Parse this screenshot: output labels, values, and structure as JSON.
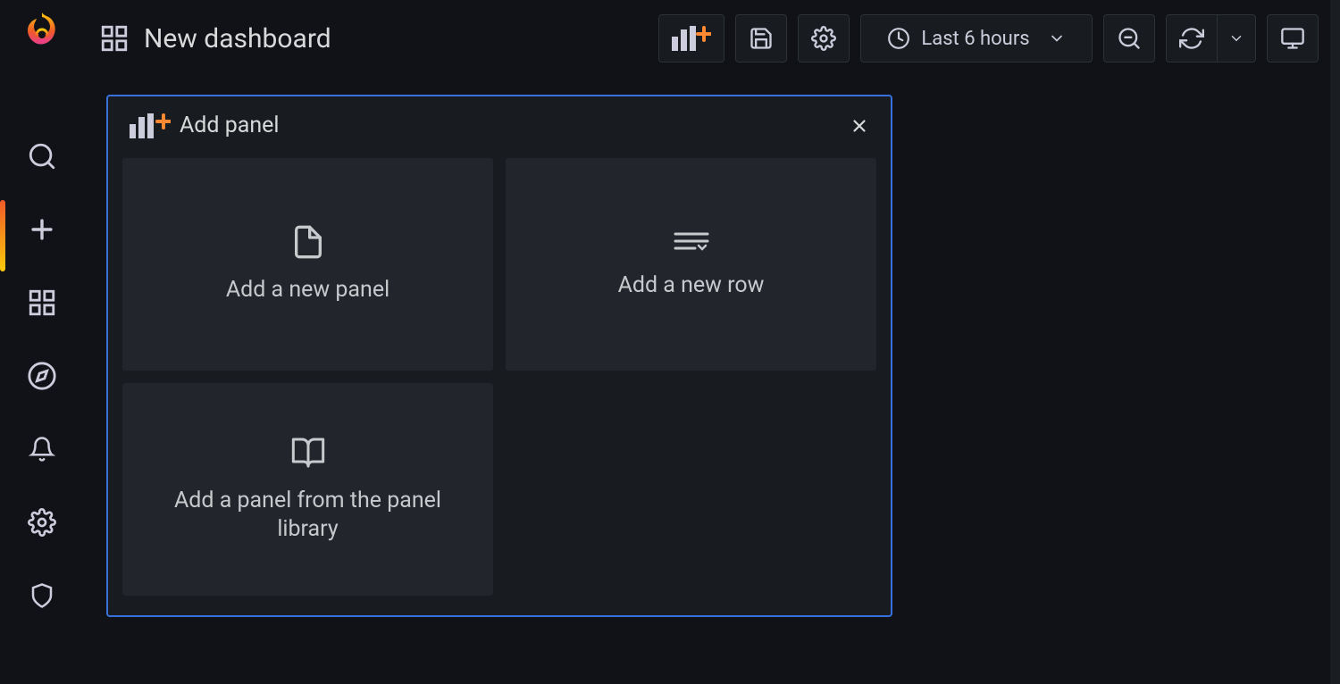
{
  "page": {
    "title": "New dashboard"
  },
  "sidebar": {
    "items": [
      {
        "icon": "search-icon"
      },
      {
        "icon": "plus-icon",
        "active": true
      },
      {
        "icon": "grid-icon"
      },
      {
        "icon": "compass-icon"
      },
      {
        "icon": "bell-icon"
      },
      {
        "icon": "gear-icon"
      },
      {
        "icon": "shield-icon"
      }
    ]
  },
  "toolbar": {
    "add_panel_icon": "add-panel-icon",
    "save_icon": "save-icon",
    "settings_icon": "gear-icon",
    "time_label": "Last 6 hours",
    "zoom_out_icon": "zoom-out-icon",
    "refresh_icon": "refresh-icon",
    "kiosk_icon": "monitor-icon"
  },
  "add_panel": {
    "header": "Add panel",
    "tiles": {
      "new_panel": "Add a new panel",
      "new_row": "Add a new row",
      "library": "Add a panel from the panel library"
    }
  }
}
